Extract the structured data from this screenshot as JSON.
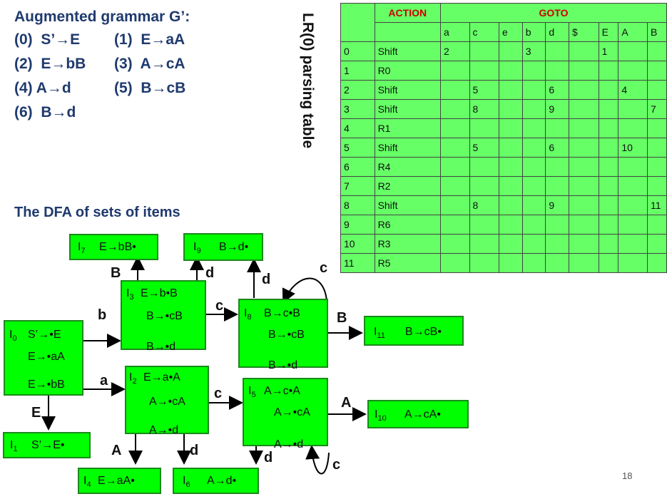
{
  "grammar": {
    "title": "Augmented grammar G’:",
    "rules": [
      "(0)  S’→E",
      "(1)  E→aA",
      "(2)  E→bB",
      "(3)  A→cA",
      "(4) A→d",
      "(5)  B→cB",
      "(6)  B→d"
    ]
  },
  "side_title": "LR(0) parsing table",
  "dfa_title": "The DFA of sets of items",
  "table": {
    "action_label": "ACTION",
    "goto_label": "GOTO",
    "symbols": [
      "a",
      "c",
      "e",
      "b",
      "d",
      "$",
      "E",
      "A",
      "B"
    ],
    "rows": [
      {
        "state": "0",
        "action": "Shift",
        "cells": [
          "2",
          "",
          "",
          "3",
          "",
          "",
          "1",
          "",
          ""
        ]
      },
      {
        "state": "1",
        "action": "R0",
        "cells": [
          "",
          "",
          "",
          "",
          "",
          "",
          "",
          "",
          ""
        ]
      },
      {
        "state": "2",
        "action": "Shift",
        "cells": [
          "",
          "5",
          "",
          "",
          "6",
          "",
          "",
          "4",
          ""
        ]
      },
      {
        "state": "3",
        "action": "Shift",
        "cells": [
          "",
          "8",
          "",
          "",
          "9",
          "",
          "",
          "",
          "7"
        ]
      },
      {
        "state": "4",
        "action": "R1",
        "cells": [
          "",
          "",
          "",
          "",
          "",
          "",
          "",
          "",
          ""
        ]
      },
      {
        "state": "5",
        "action": "Shift",
        "cells": [
          "",
          "5",
          "",
          "",
          "6",
          "",
          "",
          "10",
          ""
        ]
      },
      {
        "state": "6",
        "action": "R4",
        "cells": [
          "",
          "",
          "",
          "",
          "",
          "",
          "",
          "",
          ""
        ]
      },
      {
        "state": "7",
        "action": "R2",
        "cells": [
          "",
          "",
          "",
          "",
          "",
          "",
          "",
          "",
          ""
        ]
      },
      {
        "state": "8",
        "action": "Shift",
        "cells": [
          "",
          "8",
          "",
          "",
          "9",
          "",
          "",
          "",
          "11"
        ]
      },
      {
        "state": "9",
        "action": "R6",
        "cells": [
          "",
          "",
          "",
          "",
          "",
          "",
          "",
          "",
          ""
        ]
      },
      {
        "state": "10",
        "action": "R3",
        "cells": [
          "",
          "",
          "",
          "",
          "",
          "",
          "",
          "",
          ""
        ]
      },
      {
        "state": "11",
        "action": "R5",
        "cells": [
          "",
          "",
          "",
          "",
          "",
          "",
          "",
          "",
          ""
        ]
      }
    ]
  },
  "dfa": {
    "nodes": {
      "I0": {
        "id": "0",
        "items": [
          "S’→•E",
          "E→•aA",
          "E→•bB"
        ]
      },
      "I1": {
        "id": "1",
        "items": [
          "S’→E•"
        ]
      },
      "I2": {
        "id": "2",
        "items": [
          "E→a•A",
          "A→•cA",
          "A→•d"
        ]
      },
      "I3": {
        "id": "3",
        "items": [
          "E→b•B",
          "B→•cB",
          "B→•d"
        ]
      },
      "I4": {
        "id": "4",
        "items": [
          "E→aA•"
        ]
      },
      "I5": {
        "id": "5",
        "items": [
          "A→c•A",
          "A→•cA",
          "A→•d"
        ]
      },
      "I6": {
        "id": "6",
        "items": [
          "A→d•"
        ]
      },
      "I7": {
        "id": "7",
        "items": [
          "E→bB•"
        ]
      },
      "I8": {
        "id": "8",
        "items": [
          "B→c•B",
          "B→•cB",
          "B→•d"
        ]
      },
      "I9": {
        "id": "9",
        "items": [
          "B→d•"
        ]
      },
      "I10": {
        "id": "10",
        "items": [
          "A→cA•"
        ]
      },
      "I11": {
        "id": "11",
        "items": [
          "B→cB•"
        ]
      }
    },
    "edge_labels": {
      "b": "b",
      "a": "a",
      "E": "E",
      "A": "A",
      "B": "B",
      "c": "c",
      "d": "d"
    }
  },
  "page_number": "18"
}
